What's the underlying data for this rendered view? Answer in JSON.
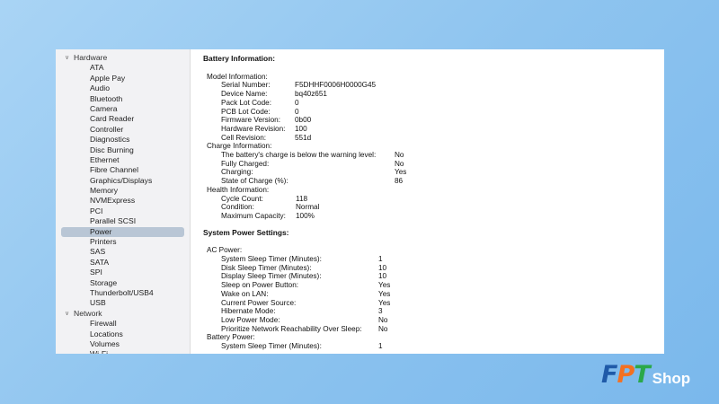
{
  "sidebar": {
    "categories": [
      {
        "label": "Hardware",
        "items": [
          "ATA",
          "Apple Pay",
          "Audio",
          "Bluetooth",
          "Camera",
          "Card Reader",
          "Controller",
          "Diagnostics",
          "Disc Burning",
          "Ethernet",
          "Fibre Channel",
          "Graphics/Displays",
          "Memory",
          "NVMExpress",
          "PCI",
          "Parallel SCSI",
          "Power",
          "Printers",
          "SAS",
          "SATA",
          "SPI",
          "Storage",
          "Thunderbolt/USB4",
          "USB"
        ]
      },
      {
        "label": "Network",
        "items": [
          "Firewall",
          "Locations",
          "Volumes",
          "Wi-Fi"
        ]
      }
    ],
    "selected": "Power"
  },
  "content": {
    "battery": {
      "title": "Battery Information:",
      "model_title": "Model Information:",
      "model": [
        [
          "Serial Number:",
          "F5DHHF0006H0000G45"
        ],
        [
          "Device Name:",
          "bq40z651"
        ],
        [
          "Pack Lot Code:",
          "0"
        ],
        [
          "PCB Lot Code:",
          "0"
        ],
        [
          "Firmware Version:",
          "0b00"
        ],
        [
          "Hardware Revision:",
          "100"
        ],
        [
          "Cell Revision:",
          "551d"
        ]
      ],
      "charge_title": "Charge Information:",
      "charge": [
        [
          "The battery's charge is below the warning level:",
          "No"
        ],
        [
          "Fully Charged:",
          "No"
        ],
        [
          "Charging:",
          "Yes"
        ],
        [
          "State of Charge (%):",
          "86"
        ]
      ],
      "health_title": "Health Information:",
      "health": [
        [
          "Cycle Count:",
          "118"
        ],
        [
          "Condition:",
          "Normal"
        ],
        [
          "Maximum Capacity:",
          "100%"
        ]
      ]
    },
    "power": {
      "title": "System Power Settings:",
      "ac_title": "AC Power:",
      "ac": [
        [
          "System Sleep Timer (Minutes):",
          "1"
        ],
        [
          "Disk Sleep Timer (Minutes):",
          "10"
        ],
        [
          "Display Sleep Timer (Minutes):",
          "10"
        ],
        [
          "Sleep on Power Button:",
          "Yes"
        ],
        [
          "Wake on LAN:",
          "Yes"
        ],
        [
          "Current Power Source:",
          "Yes"
        ],
        [
          "Hibernate Mode:",
          "3"
        ],
        [
          "Low Power Mode:",
          "No"
        ],
        [
          "Prioritize Network Reachability Over Sleep:",
          "No"
        ]
      ],
      "battery_title": "Battery Power:",
      "battery": [
        [
          "System Sleep Timer (Minutes):",
          "1"
        ]
      ]
    }
  },
  "watermark": {
    "brand": "FPT",
    "brand_suffix": "Shop",
    "letter_colors": [
      "#1f5aa8",
      "#f37021",
      "#2aa84a"
    ]
  }
}
